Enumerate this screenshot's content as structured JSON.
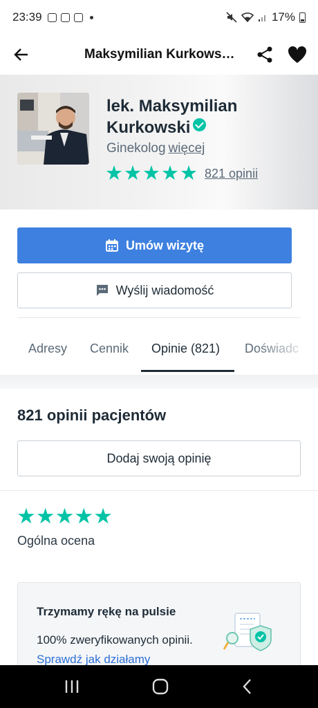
{
  "status_bar": {
    "time": "23:39",
    "battery": "17%"
  },
  "app_bar": {
    "title": "Maksymilian Kurkows…"
  },
  "profile": {
    "name": "lek. Maksymilian Kurkowski",
    "specialty": "Ginekolog",
    "more_link": "więcej",
    "stars": 5,
    "reviews_link": "821 opinii"
  },
  "actions": {
    "book_label": "Umów wizytę",
    "message_label": "Wyślij wiadomość"
  },
  "tabs": [
    {
      "label": "Adresy"
    },
    {
      "label": "Cennik"
    },
    {
      "label": "Opinie (821)"
    },
    {
      "label": "Doświadc"
    }
  ],
  "active_tab": "Opinie (821)",
  "reviews": {
    "title": "821 opinii pacjentów",
    "add_label": "Dodaj swoją opinię",
    "overall_stars": 5,
    "overall_label": "Ogólna ocena"
  },
  "info_box": {
    "title": "Trzymamy rękę na pulsie",
    "text": "100% zweryfikowanych opinii.",
    "link": "Sprawdź jak działamy"
  },
  "colors": {
    "accent": "#3d80e0",
    "star": "#00c3a5",
    "text": "#1e2b36",
    "muted": "#5b6a78"
  }
}
